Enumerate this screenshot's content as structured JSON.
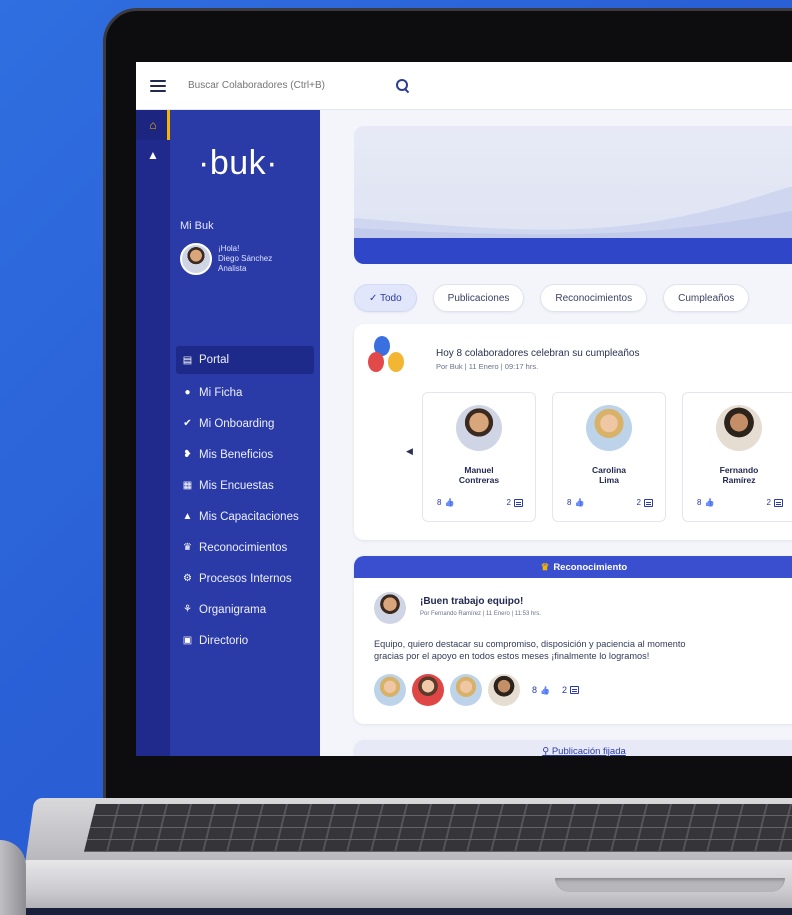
{
  "search": {
    "placeholder": "Buscar Colaboradores (Ctrl+B)"
  },
  "sidebar": {
    "logo": "·buk·",
    "section": "Mi Buk",
    "profile": {
      "greeting": "¡Hola!",
      "name": "Diego Sánchez",
      "role": "Analista"
    },
    "items": [
      {
        "label": "Portal",
        "icon": "portal-icon",
        "glyph": "▤"
      },
      {
        "label": "Mi Ficha",
        "icon": "user-icon",
        "glyph": "●"
      },
      {
        "label": "Mi Onboarding",
        "icon": "check-icon",
        "glyph": "✔"
      },
      {
        "label": "Mis Beneficios",
        "icon": "gift-icon",
        "glyph": "❥"
      },
      {
        "label": "Mis Encuestas",
        "icon": "survey-icon",
        "glyph": "▦"
      },
      {
        "label": "Mis Capacitaciones",
        "icon": "graduation-icon",
        "glyph": "▲"
      },
      {
        "label": "Reconocimientos",
        "icon": "trophy-icon",
        "glyph": "♛"
      },
      {
        "label": "Procesos Internos",
        "icon": "process-icon",
        "glyph": "⚙"
      },
      {
        "label": "Organigrama",
        "icon": "org-chart-icon",
        "glyph": "⚘"
      },
      {
        "label": "Directorio",
        "icon": "directory-icon",
        "glyph": "▣"
      }
    ]
  },
  "rail": [
    {
      "icon": "home-icon",
      "glyph": "⌂"
    },
    {
      "icon": "graduation-icon",
      "glyph": "▲"
    }
  ],
  "filters": {
    "active": "✓ Todo",
    "items": [
      "Publicaciones",
      "Reconocimientos",
      "Cumpleaños"
    ]
  },
  "birthdays": {
    "title": "Hoy 8 colaboradores celebran su cumpleaños",
    "meta": "Por Buk | 11 Enero | 09:17 hrs.",
    "people": [
      {
        "first": "Manuel",
        "last": "Contreras",
        "likes": "8",
        "comments": "2"
      },
      {
        "first": "Carolina",
        "last": "Lima",
        "likes": "8",
        "comments": "2"
      },
      {
        "first": "Fernando",
        "last": "Ramírez",
        "likes": "8",
        "comments": "2"
      }
    ]
  },
  "recognition": {
    "header": "Reconocimiento",
    "title": "¡Buen trabajo equipo!",
    "meta": "Por Fernando Ramírez | 11 Enero | 11:53 hrs.",
    "body1": "Equipo, quiero destacar su compromiso, disposición y paciencia al momento",
    "body2": "gracias por el apoyo en todos estos meses ¡finalmente lo logramos!",
    "likes": "8",
    "comments": "2"
  },
  "pinned": {
    "header": "Publicación fijada"
  },
  "colors": {
    "brand": "#2a3aa6",
    "accent": "#f5b400",
    "header": "#3a4fd0"
  }
}
